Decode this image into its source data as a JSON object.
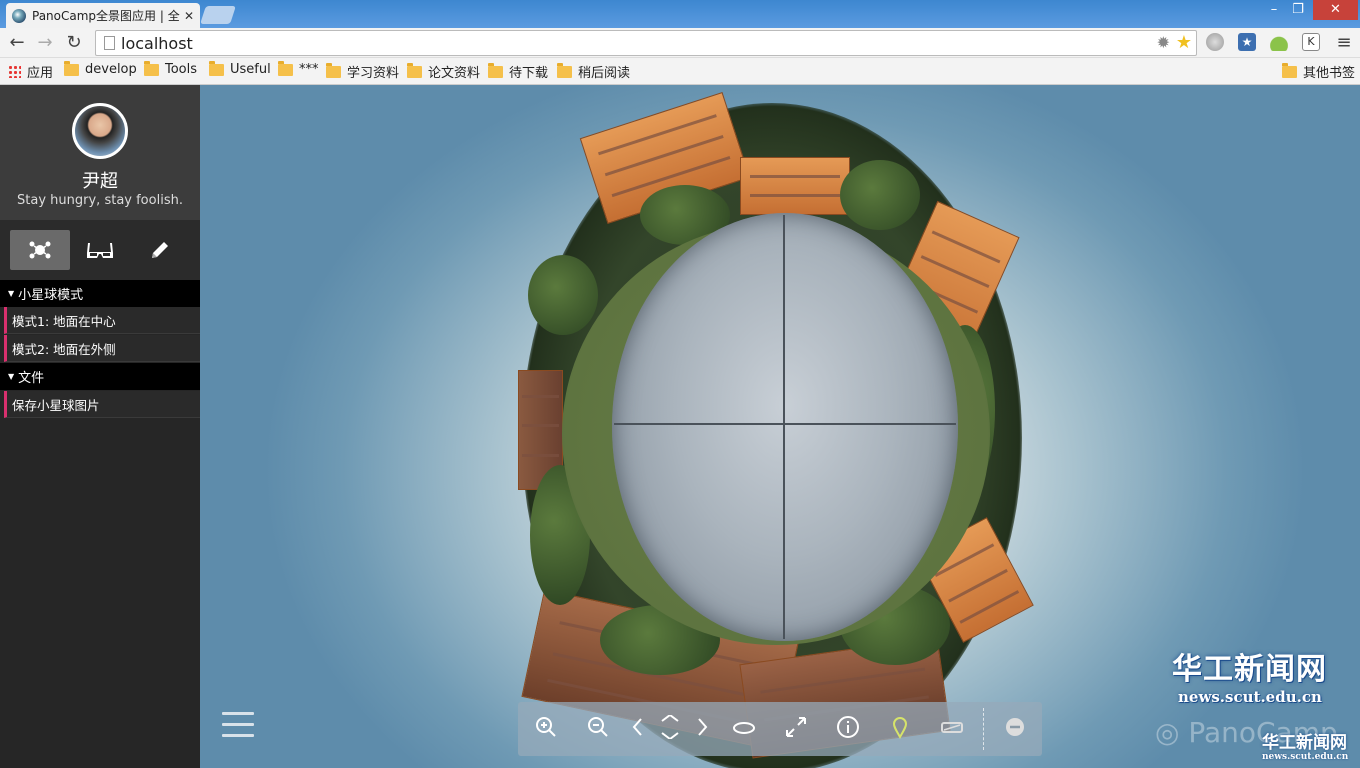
{
  "browser": {
    "tab_title": "PanoCamp全景图应用 | 全",
    "tab_close": "✕",
    "url": "localhost",
    "window_buttons": {
      "minimize": "–",
      "restore": "❐",
      "close": "✕"
    },
    "bookmarks": [
      "应用",
      "develop",
      "Tools",
      "Useful",
      "***",
      "学习资料",
      "论文资料",
      "待下载",
      "稍后阅读"
    ],
    "other_bookmarks": "其他书签"
  },
  "sidebar": {
    "user_name": "尹超",
    "motto": "Stay hungry, stay foolish.",
    "icon_tabs": [
      {
        "icon": "tiny-planet-icon",
        "active": true
      },
      {
        "icon": "vr-glasses-icon",
        "active": false
      },
      {
        "icon": "pencil-icon",
        "active": false
      }
    ],
    "sections": [
      {
        "title": "小星球模式",
        "items": [
          "模式1: 地面在中心",
          "模式2: 地面在外侧"
        ]
      },
      {
        "title": "文件",
        "items": [
          "保存小星球图片"
        ]
      }
    ]
  },
  "controls": [
    "zoom-in-icon",
    "zoom-out-icon",
    "pan-left-icon",
    "pan-updown-icon",
    "pan-right-icon",
    "orbit-icon",
    "fullscreen-icon",
    "info-icon",
    "location-pin-icon",
    "vr-mode-icon",
    "collapse-icon"
  ],
  "watermark": {
    "logo_text": "华工新闻网",
    "logo_url": "news.scut.edu.cn",
    "pano_text": "PanoCamp",
    "small_logo_text": "华工新闻网",
    "small_logo_url": "news.scut.edu.cn"
  },
  "colors": {
    "accent": "#d9306e",
    "sidebar_bg": "#262626",
    "profile_bg": "#3c3c3c"
  }
}
